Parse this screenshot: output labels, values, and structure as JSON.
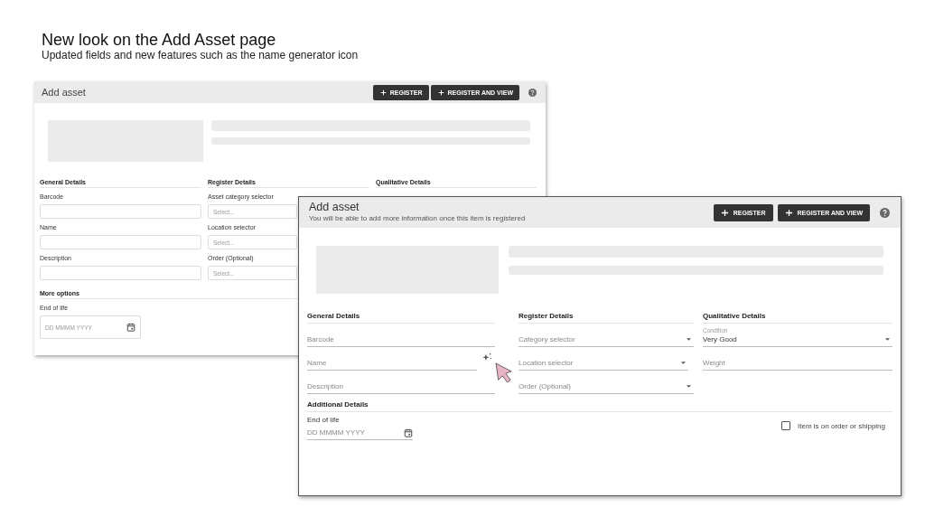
{
  "slide": {
    "title": "New look on the Add Asset page",
    "subtitle": "Updated fields and new features such as the name generator icon"
  },
  "old_window": {
    "title": "Add asset",
    "buttons": [
      "REGISTER",
      "REGISTER AND VIEW"
    ],
    "columns": [
      {
        "heading": "General Details",
        "fields": [
          {
            "label": "Barcode"
          },
          {
            "label": "Name"
          },
          {
            "label": "Description"
          }
        ]
      },
      {
        "heading": "Register Details",
        "fields": [
          {
            "label": "Asset category selector",
            "placeholder": "Select..."
          },
          {
            "label": "Location selector",
            "placeholder": "Select..."
          },
          {
            "label": "Order (Optional)",
            "placeholder": "Select..."
          }
        ]
      },
      {
        "heading": "Qualitative Details"
      }
    ],
    "more_options": {
      "heading": "More options",
      "field_label": "End of life",
      "placeholder": "DD MMMM YYYY"
    }
  },
  "new_window": {
    "title": "Add asset",
    "subtitle": "You will be able to add more information once this item is registered",
    "buttons": [
      "REGISTER",
      "REGISTER AND VIEW"
    ],
    "columns": [
      {
        "heading": "General Details",
        "fields": [
          {
            "kind": "text",
            "placeholder": "Barcode"
          },
          {
            "kind": "generator",
            "placeholder": "Name"
          },
          {
            "kind": "text",
            "placeholder": "Description"
          }
        ]
      },
      {
        "heading": "Register Details",
        "fields": [
          {
            "kind": "select",
            "placeholder": "Category selector"
          },
          {
            "kind": "select_refresh",
            "placeholder": "Location selector"
          },
          {
            "kind": "select",
            "placeholder": "Order (Optional)"
          }
        ]
      },
      {
        "heading": "Qualitative Details",
        "fields": [
          {
            "kind": "select",
            "label": "Condition",
            "value": "Very Good"
          },
          {
            "kind": "text",
            "placeholder": "Weight"
          }
        ]
      }
    ],
    "additional": {
      "heading": "Additional Details",
      "field_label": "End of life",
      "placeholder": "DD MMMM YYYY",
      "checkbox": {
        "label": "Item is on order or shipping",
        "checked": false
      }
    }
  }
}
